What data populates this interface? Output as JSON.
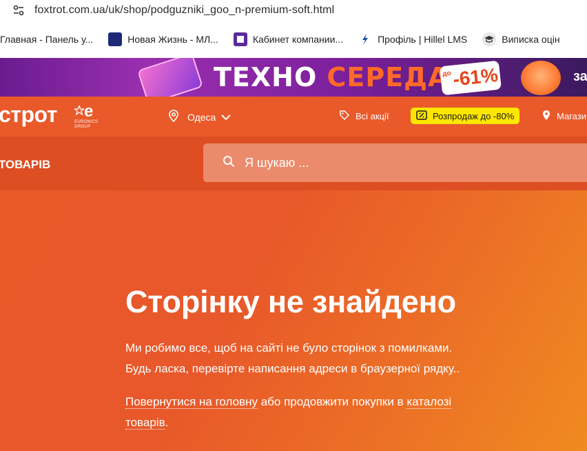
{
  "browser": {
    "url": "foxtrot.com.ua/uk/shop/podguzniki_goo_n-premium-soft.html",
    "bookmarks": [
      {
        "label": "Главная - Панель у...",
        "icon": "blank-icon",
        "color": ""
      },
      {
        "label": "Новая Жизнь - МЛ...",
        "icon": "new-life-icon",
        "color": "#1e2a78"
      },
      {
        "label": "Кабинет компании...",
        "icon": "square-icon",
        "color": "#5b2b9b"
      },
      {
        "label": "Профіль | Hillel LMS",
        "icon": "hillel-icon",
        "color": "#1e4ba8"
      },
      {
        "label": "Виписка оцін",
        "icon": "grad-cap-icon",
        "color": "#444444"
      }
    ]
  },
  "banner": {
    "word1": "ТЕХНО",
    "word2": "СЕРЕДА",
    "discount_prefix": "до",
    "discount": "-61%",
    "tail": "за"
  },
  "header": {
    "logo": "строт",
    "partner_mark": "е",
    "partner_name": "EURONICS GROUP",
    "city": "Одеса",
    "promos_label": "Всі акції",
    "sale_label": "Розпродаж до -80%",
    "stores_label": "Магази"
  },
  "nav": {
    "catalog_label": "ТОВАРІВ",
    "search_placeholder": "Я шукаю ..."
  },
  "content": {
    "title": "Сторінку не знайдено",
    "desc_line1": "Ми робимо все, щоб на сайті не було сторінок з помилками.",
    "desc_line2": "Будь ласка, перевірте написання адреси в браузерної рядку..",
    "home_link": "Повернутися на головну",
    "middle_text": " або продовжити покупки в ",
    "catalog_link_part1": "каталозі",
    "catalog_link_part2": "товарів",
    "end_text": "."
  },
  "colors": {
    "brand_orange": "#e9592a",
    "sale_yellow": "#ffe600"
  }
}
